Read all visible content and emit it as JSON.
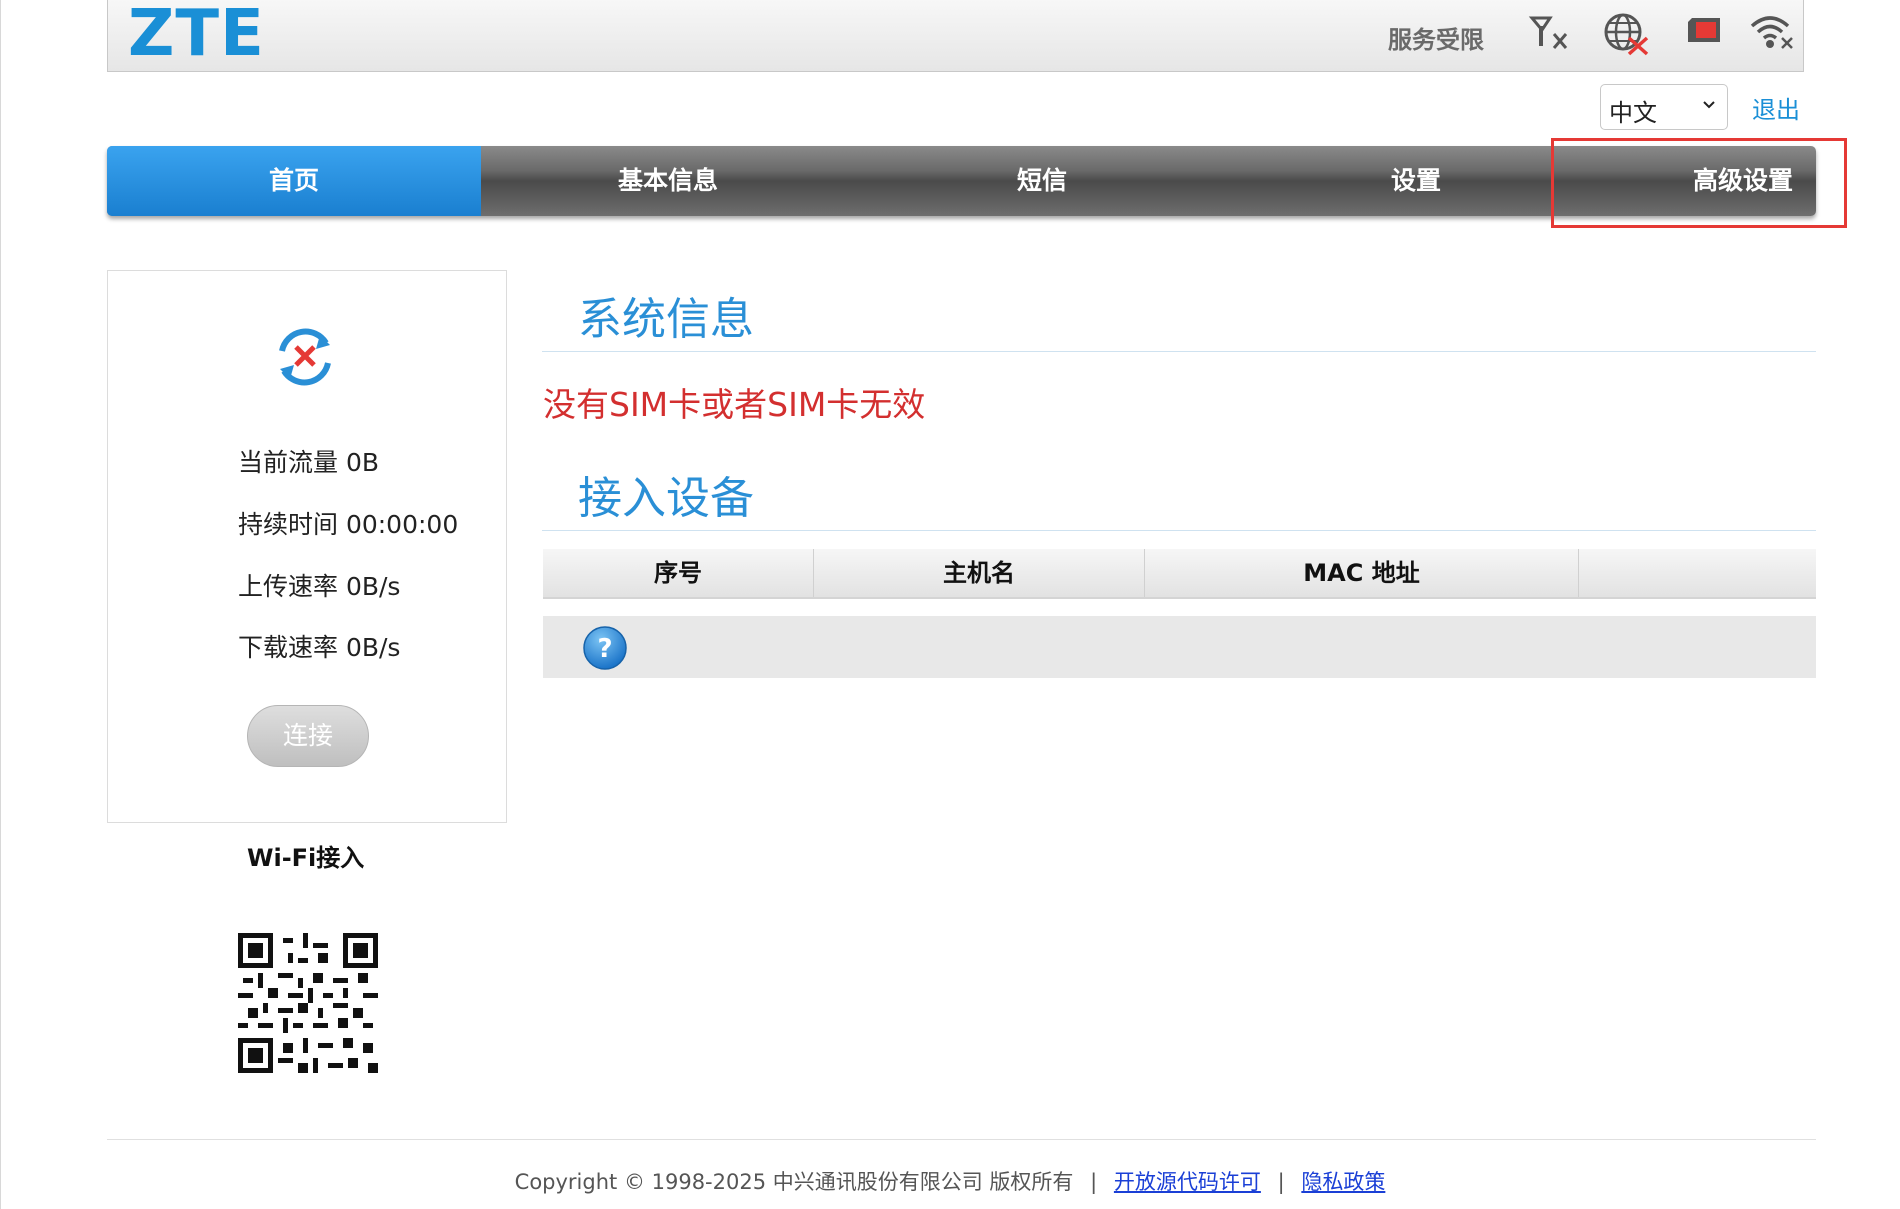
{
  "header": {
    "logo": "ZTE",
    "service_status": "服务受限",
    "icons": [
      "signal-none-icon",
      "network-disconnected-icon",
      "sim-card-icon",
      "wifi-disconnected-icon"
    ]
  },
  "language": {
    "selected": "中文",
    "logout_label": "退出"
  },
  "nav": {
    "items": [
      {
        "label": "首页",
        "active": true
      },
      {
        "label": "基本信息",
        "active": false
      },
      {
        "label": "短信",
        "active": false
      },
      {
        "label": "设置",
        "active": false
      },
      {
        "label": "高级设置",
        "active": false
      }
    ]
  },
  "status_panel": {
    "icon": "connection-disconnected-icon",
    "current_flow": "当前流量 0B",
    "duration": "持续时间 00:00:00",
    "upload_rate": "上传速率 0B/s",
    "download_rate": "下载速率 0B/s",
    "connect_label": "连接"
  },
  "wifi": {
    "access_label": "Wi-Fi接入",
    "qr_icon": "qr-code-icon"
  },
  "system_info": {
    "title": "系统信息",
    "warning": "没有SIM卡或者SIM卡无效"
  },
  "devices": {
    "title": "接入设备",
    "columns": [
      "序号",
      "主机名",
      "MAC 地址",
      ""
    ],
    "empty_icon": "help-icon"
  },
  "footer": {
    "copyright": "Copyright © 1998-2025 中兴通讯股份有限公司 版权所有",
    "open_source_label": "开放源代码许可",
    "privacy_label": "隐私政策",
    "separator": "|"
  },
  "colors": {
    "accent": "#1a8fd6",
    "warning": "#d32f2f",
    "nav_active": "#1a7fd0",
    "nav_bg": "#5a5a5a",
    "highlight": "#e53935"
  }
}
